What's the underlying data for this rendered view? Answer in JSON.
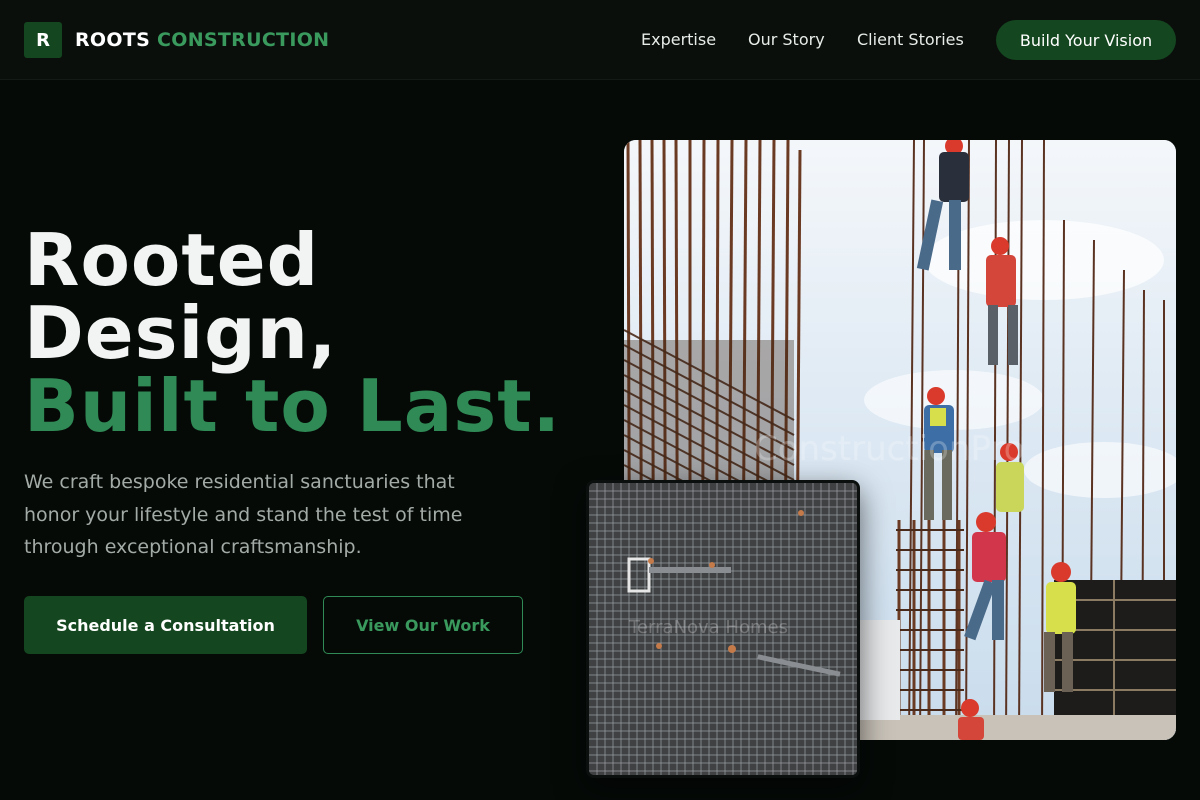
{
  "brand": {
    "initial": "R",
    "name_part1": "ROOTS",
    "name_part2": "CONSTRUCTION"
  },
  "nav": {
    "links": [
      "Expertise",
      "Our Story",
      "Client Stories"
    ],
    "cta": "Build Your Vision"
  },
  "hero": {
    "headline_line1": "Rooted",
    "headline_line2": "Design,",
    "headline_line3": "Built to Last.",
    "description": "We craft bespoke residential sanctuaries that honor your lifestyle and stand the test of time through exceptional craftsmanship.",
    "primary_button": "Schedule a Consultation",
    "secondary_button": "View Our Work"
  },
  "images": {
    "main_alt": "Construction workers climbing steel rebar columns",
    "inset_alt": "Aerial view of steel mesh reinforcement grid"
  },
  "colors": {
    "background": "#050a07",
    "accent_green": "#2f8a55",
    "button_green": "#14461f",
    "muted_text": "#a3aba7"
  }
}
